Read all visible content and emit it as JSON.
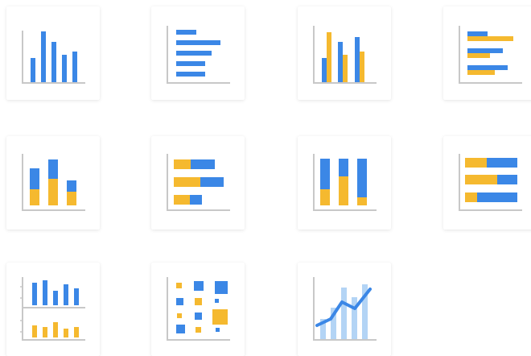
{
  "colors": {
    "blue": "#3b87e6",
    "yellow": "#f5b92f",
    "light_blue": "#b3d4f5",
    "axis": "#c8c8c8",
    "tile_background": "#ffffff"
  },
  "chart_types": [
    {
      "name": "column-chart-icon"
    },
    {
      "name": "bar-chart-icon"
    },
    {
      "name": "clustered-column-chart-icon"
    },
    {
      "name": "clustered-bar-chart-icon"
    },
    {
      "name": "stacked-column-chart-icon"
    },
    {
      "name": "stacked-bar-chart-icon"
    },
    {
      "name": "100-percent-stacked-column-chart-icon"
    },
    {
      "name": "100-percent-stacked-bar-chart-icon"
    },
    {
      "name": "split-column-chart-icon"
    },
    {
      "name": "scatter-chart-icon"
    },
    {
      "name": "combo-line-column-chart-icon"
    }
  ]
}
